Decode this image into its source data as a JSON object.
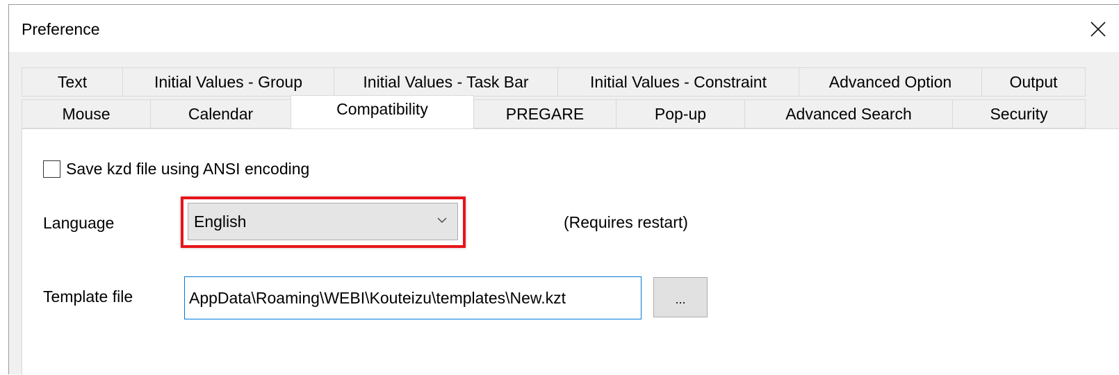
{
  "window": {
    "title": "Preference",
    "close_glyph": "close-icon"
  },
  "tabs": {
    "row_back": [
      {
        "label": "Text"
      },
      {
        "label": "Initial Values - Group"
      },
      {
        "label": "Initial Values - Task Bar"
      },
      {
        "label": "Initial Values - Constraint"
      },
      {
        "label": "Advanced Option"
      },
      {
        "label": "Output"
      }
    ],
    "row_front": [
      {
        "label": "Mouse"
      },
      {
        "label": "Calendar"
      },
      {
        "label": "Compatibility",
        "active": true
      },
      {
        "label": "PREGARE"
      },
      {
        "label": "Pop-up"
      },
      {
        "label": "Advanced Search"
      },
      {
        "label": "Security"
      }
    ]
  },
  "compatibility": {
    "ansi_checkbox_label": "Save kzd file using ANSI encoding",
    "ansi_checked": false,
    "language_label": "Language",
    "language_value": "English",
    "restart_note": "(Requires restart)",
    "template_label": "Template file",
    "template_value": "AppData\\Roaming\\WEBI\\Kouteizu\\templates\\New.kzt",
    "browse_label": "..."
  },
  "colors": {
    "highlight": "#e8141b",
    "focus_border": "#0078d7"
  }
}
